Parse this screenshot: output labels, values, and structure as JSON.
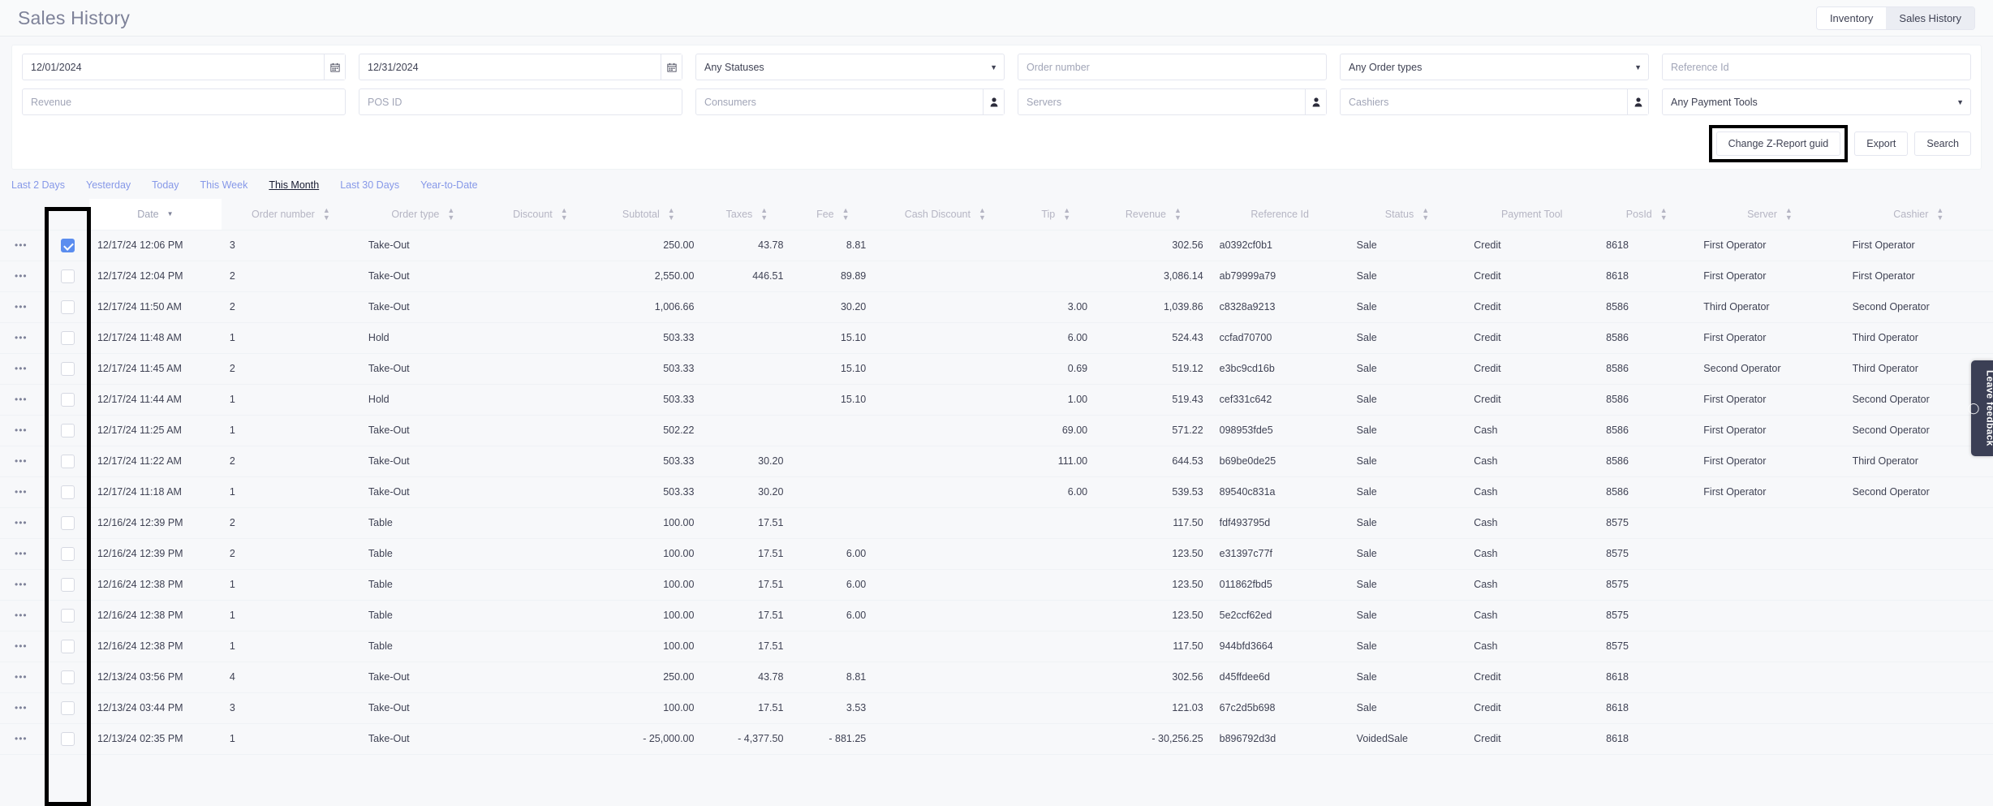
{
  "header": {
    "title": "Sales History",
    "tabs": [
      {
        "label": "Inventory",
        "active": false
      },
      {
        "label": "Sales History",
        "active": true
      }
    ]
  },
  "filters": {
    "date_from": {
      "value": "12/01/2024",
      "icon": "calendar-icon"
    },
    "date_to": {
      "value": "12/31/2024",
      "icon": "calendar-icon"
    },
    "status": {
      "value": "Any Statuses",
      "icon": "chevron-down-icon"
    },
    "order_number": {
      "placeholder": "Order number"
    },
    "order_type": {
      "value": "Any Order types",
      "icon": "chevron-down-icon"
    },
    "reference_id": {
      "placeholder": "Reference Id"
    },
    "revenue": {
      "placeholder": "Revenue"
    },
    "pos_id": {
      "placeholder": "POS ID"
    },
    "consumers": {
      "placeholder": "Consumers",
      "icon": "person-icon"
    },
    "servers": {
      "placeholder": "Servers",
      "icon": "person-icon"
    },
    "cashiers": {
      "placeholder": "Cashiers",
      "icon": "person-icon"
    },
    "payment_tool": {
      "value": "Any Payment Tools",
      "icon": "chevron-down-icon"
    }
  },
  "buttons": {
    "change_z_report": "Change Z-Report guid",
    "export": "Export",
    "search": "Search"
  },
  "quick_ranges": [
    {
      "label": "Last 2 Days",
      "active": false
    },
    {
      "label": "Yesterday",
      "active": false
    },
    {
      "label": "Today",
      "active": false
    },
    {
      "label": "This Week",
      "active": false
    },
    {
      "label": "This Month",
      "active": true
    },
    {
      "label": "Last 30 Days",
      "active": false
    },
    {
      "label": "Year-to-Date",
      "active": false
    }
  ],
  "table": {
    "columns": [
      {
        "label": "",
        "key": "actions",
        "sortable": false
      },
      {
        "label": "",
        "key": "select",
        "sortable": false
      },
      {
        "label": "Date",
        "key": "date",
        "sortable": true,
        "sorted": true
      },
      {
        "label": "Order number",
        "key": "order_number",
        "sortable": true
      },
      {
        "label": "Order type",
        "key": "order_type",
        "sortable": true
      },
      {
        "label": "Discount",
        "key": "discount",
        "sortable": true
      },
      {
        "label": "Subtotal",
        "key": "subtotal",
        "sortable": true
      },
      {
        "label": "Taxes",
        "key": "taxes",
        "sortable": true
      },
      {
        "label": "Fee",
        "key": "fee",
        "sortable": true
      },
      {
        "label": "Cash Discount",
        "key": "cash_discount",
        "sortable": true
      },
      {
        "label": "Tip",
        "key": "tip",
        "sortable": true
      },
      {
        "label": "Revenue",
        "key": "revenue",
        "sortable": true
      },
      {
        "label": "Reference Id",
        "key": "reference_id",
        "sortable": false
      },
      {
        "label": "Status",
        "key": "status",
        "sortable": true
      },
      {
        "label": "Payment Tool",
        "key": "payment_tool",
        "sortable": false
      },
      {
        "label": "PosId",
        "key": "posid",
        "sortable": true
      },
      {
        "label": "Server",
        "key": "server",
        "sortable": true
      },
      {
        "label": "Cashier",
        "key": "cashier",
        "sortable": true
      }
    ],
    "rows": [
      {
        "selected": true,
        "date": "12/17/24 12:06 PM",
        "order_number": "3",
        "order_type": "Take-Out",
        "discount": "",
        "subtotal": "250.00",
        "taxes": "43.78",
        "fee": "8.81",
        "cash_discount": "",
        "tip": "",
        "revenue": "302.56",
        "revenue_negative": false,
        "reference_id": "a0392cf0b1",
        "status": "Sale",
        "payment_tool": "Credit",
        "posid": "8618",
        "server": "First Operator",
        "cashier": "First Operator"
      },
      {
        "selected": false,
        "date": "12/17/24 12:04 PM",
        "order_number": "2",
        "order_type": "Take-Out",
        "discount": "",
        "subtotal": "2,550.00",
        "taxes": "446.51",
        "fee": "89.89",
        "cash_discount": "",
        "tip": "",
        "revenue": "3,086.14",
        "revenue_negative": false,
        "reference_id": "ab79999a79",
        "status": "Sale",
        "payment_tool": "Credit",
        "posid": "8618",
        "server": "First Operator",
        "cashier": "First Operator"
      },
      {
        "selected": false,
        "date": "12/17/24 11:50 AM",
        "order_number": "2",
        "order_type": "Take-Out",
        "discount": "",
        "subtotal": "1,006.66",
        "taxes": "",
        "fee": "30.20",
        "cash_discount": "",
        "tip": "3.00",
        "revenue": "1,039.86",
        "revenue_negative": false,
        "reference_id": "c8328a9213",
        "status": "Sale",
        "payment_tool": "Credit",
        "posid": "8586",
        "server": "Third Operator",
        "cashier": "Second Operator"
      },
      {
        "selected": false,
        "date": "12/17/24 11:48 AM",
        "order_number": "1",
        "order_type": "Hold",
        "discount": "",
        "subtotal": "503.33",
        "taxes": "",
        "fee": "15.10",
        "cash_discount": "",
        "tip": "6.00",
        "revenue": "524.43",
        "revenue_negative": false,
        "reference_id": "ccfad70700",
        "status": "Sale",
        "payment_tool": "Credit",
        "posid": "8586",
        "server": "First Operator",
        "cashier": "Third Operator"
      },
      {
        "selected": false,
        "date": "12/17/24 11:45 AM",
        "order_number": "2",
        "order_type": "Take-Out",
        "discount": "",
        "subtotal": "503.33",
        "taxes": "",
        "fee": "15.10",
        "cash_discount": "",
        "tip": "0.69",
        "revenue": "519.12",
        "revenue_negative": false,
        "reference_id": "e3bc9cd16b",
        "status": "Sale",
        "payment_tool": "Credit",
        "posid": "8586",
        "server": "Second Operator",
        "cashier": "Third Operator"
      },
      {
        "selected": false,
        "date": "12/17/24 11:44 AM",
        "order_number": "1",
        "order_type": "Hold",
        "discount": "",
        "subtotal": "503.33",
        "taxes": "",
        "fee": "15.10",
        "cash_discount": "",
        "tip": "1.00",
        "revenue": "519.43",
        "revenue_negative": false,
        "reference_id": "cef331c642",
        "status": "Sale",
        "payment_tool": "Credit",
        "posid": "8586",
        "server": "First Operator",
        "cashier": "Second Operator"
      },
      {
        "selected": false,
        "date": "12/17/24 11:25 AM",
        "order_number": "1",
        "order_type": "Take-Out",
        "discount": "",
        "subtotal": "502.22",
        "taxes": "",
        "fee": "",
        "cash_discount": "",
        "tip": "69.00",
        "revenue": "571.22",
        "revenue_negative": false,
        "reference_id": "098953fde5",
        "status": "Sale",
        "payment_tool": "Cash",
        "posid": "8586",
        "server": "First Operator",
        "cashier": "Second Operator"
      },
      {
        "selected": false,
        "date": "12/17/24 11:22 AM",
        "order_number": "2",
        "order_type": "Take-Out",
        "discount": "",
        "subtotal": "503.33",
        "taxes": "30.20",
        "fee": "",
        "cash_discount": "",
        "tip": "111.00",
        "revenue": "644.53",
        "revenue_negative": false,
        "reference_id": "b69be0de25",
        "status": "Sale",
        "payment_tool": "Cash",
        "posid": "8586",
        "server": "First Operator",
        "cashier": "Third Operator"
      },
      {
        "selected": false,
        "date": "12/17/24 11:18 AM",
        "order_number": "1",
        "order_type": "Take-Out",
        "discount": "",
        "subtotal": "503.33",
        "taxes": "30.20",
        "fee": "",
        "cash_discount": "",
        "tip": "6.00",
        "revenue": "539.53",
        "revenue_negative": false,
        "reference_id": "89540c831a",
        "status": "Sale",
        "payment_tool": "Cash",
        "posid": "8586",
        "server": "First Operator",
        "cashier": "Second Operator"
      },
      {
        "selected": false,
        "date": "12/16/24 12:39 PM",
        "order_number": "2",
        "order_type": "Table",
        "discount": "",
        "subtotal": "100.00",
        "taxes": "17.51",
        "fee": "",
        "cash_discount": "",
        "tip": "",
        "revenue": "117.50",
        "revenue_negative": false,
        "reference_id": "fdf493795d",
        "status": "Sale",
        "payment_tool": "Cash",
        "posid": "8575",
        "server": "",
        "cashier": ""
      },
      {
        "selected": false,
        "date": "12/16/24 12:39 PM",
        "order_number": "2",
        "order_type": "Table",
        "discount": "",
        "subtotal": "100.00",
        "taxes": "17.51",
        "fee": "6.00",
        "cash_discount": "",
        "tip": "",
        "revenue": "123.50",
        "revenue_negative": false,
        "reference_id": "e31397c77f",
        "status": "Sale",
        "payment_tool": "Cash",
        "posid": "8575",
        "server": "",
        "cashier": ""
      },
      {
        "selected": false,
        "date": "12/16/24 12:38 PM",
        "order_number": "1",
        "order_type": "Table",
        "discount": "",
        "subtotal": "100.00",
        "taxes": "17.51",
        "fee": "6.00",
        "cash_discount": "",
        "tip": "",
        "revenue": "123.50",
        "revenue_negative": false,
        "reference_id": "011862fbd5",
        "status": "Sale",
        "payment_tool": "Cash",
        "posid": "8575",
        "server": "",
        "cashier": ""
      },
      {
        "selected": false,
        "date": "12/16/24 12:38 PM",
        "order_number": "1",
        "order_type": "Table",
        "discount": "",
        "subtotal": "100.00",
        "taxes": "17.51",
        "fee": "6.00",
        "cash_discount": "",
        "tip": "",
        "revenue": "123.50",
        "revenue_negative": false,
        "reference_id": "5e2ccf62ed",
        "status": "Sale",
        "payment_tool": "Cash",
        "posid": "8575",
        "server": "",
        "cashier": ""
      },
      {
        "selected": false,
        "date": "12/16/24 12:38 PM",
        "order_number": "1",
        "order_type": "Table",
        "discount": "",
        "subtotal": "100.00",
        "taxes": "17.51",
        "fee": "",
        "cash_discount": "",
        "tip": "",
        "revenue": "117.50",
        "revenue_negative": false,
        "reference_id": "944bfd3664",
        "status": "Sale",
        "payment_tool": "Cash",
        "posid": "8575",
        "server": "",
        "cashier": ""
      },
      {
        "selected": false,
        "date": "12/13/24 03:56 PM",
        "order_number": "4",
        "order_type": "Take-Out",
        "discount": "",
        "subtotal": "250.00",
        "taxes": "43.78",
        "fee": "8.81",
        "cash_discount": "",
        "tip": "",
        "revenue": "302.56",
        "revenue_negative": false,
        "reference_id": "d45ffdee6d",
        "status": "Sale",
        "payment_tool": "Credit",
        "posid": "8618",
        "server": "",
        "cashier": ""
      },
      {
        "selected": false,
        "date": "12/13/24 03:44 PM",
        "order_number": "3",
        "order_type": "Take-Out",
        "discount": "",
        "subtotal": "100.00",
        "taxes": "17.51",
        "fee": "3.53",
        "cash_discount": "",
        "tip": "",
        "revenue": "121.03",
        "revenue_negative": false,
        "reference_id": "67c2d5b698",
        "status": "Sale",
        "payment_tool": "Credit",
        "posid": "8618",
        "server": "",
        "cashier": ""
      },
      {
        "selected": false,
        "date": "12/13/24 02:35 PM",
        "order_number": "1",
        "order_type": "Take-Out",
        "discount": "",
        "subtotal": "- 25,000.00",
        "taxes": "- 4,377.50",
        "fee": "- 881.25",
        "cash_discount": "",
        "tip": "",
        "revenue": "- 30,256.25",
        "revenue_negative": true,
        "reference_id": "b896792d3d",
        "status": "VoidedSale",
        "payment_tool": "Credit",
        "posid": "8618",
        "server": "",
        "cashier": ""
      }
    ]
  },
  "feedback": {
    "label": "Leave feedback",
    "icon": "speech-bubble-icon"
  },
  "colors": {
    "accent": "#5b8def",
    "link": "#8698e8",
    "negative": "#f1416c",
    "highlight": "#000000"
  }
}
